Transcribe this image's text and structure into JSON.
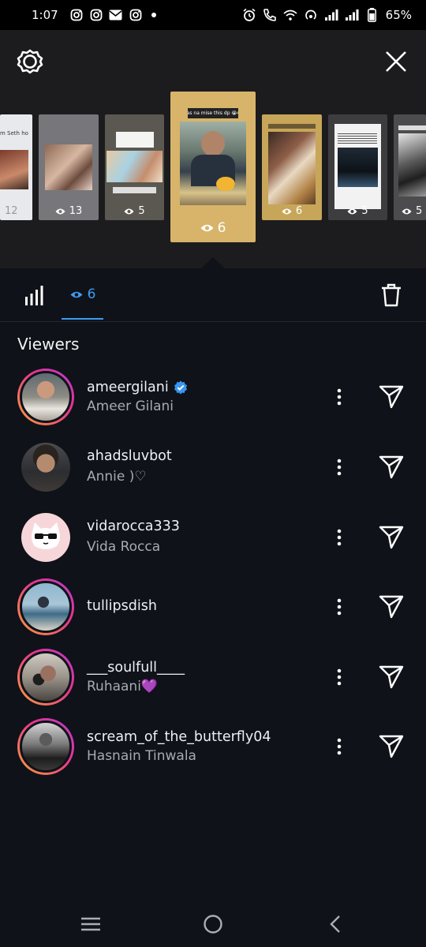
{
  "status_bar": {
    "time": "1:07",
    "battery": "65%"
  },
  "stories": [
    {
      "views": "12"
    },
    {
      "views": "13"
    },
    {
      "views": "5"
    },
    {
      "views": "6",
      "selected": true,
      "caption": "Bas na mise this dp 😭😭"
    },
    {
      "views": "6"
    },
    {
      "views": "5"
    },
    {
      "views": "5"
    }
  ],
  "tabs": {
    "viewers_count": "6"
  },
  "viewers_title": "Viewers",
  "viewers": [
    {
      "username": "ameergilani",
      "name": "Ameer Gilani",
      "verified": true,
      "story_ring": true
    },
    {
      "username": "ahadsluvbot",
      "name": "Annie )♡",
      "verified": false,
      "story_ring": false
    },
    {
      "username": "vidarocca333",
      "name": "Vida Rocca",
      "verified": false,
      "story_ring": false
    },
    {
      "username": "tullipsdish",
      "name": "",
      "verified": false,
      "story_ring": true
    },
    {
      "username": "___soulfull____",
      "name": "Ruhaani💜",
      "verified": false,
      "story_ring": true
    },
    {
      "username": "scream_of_the_butterfly04",
      "name": "Hasnain Tinwala",
      "verified": false,
      "story_ring": true
    }
  ],
  "colors": {
    "accent": "#3f9bf2",
    "background": "#0f1218",
    "top_panel": "#1c1c1e",
    "verified": "#3897f0"
  },
  "icons": {
    "settings": "gear-icon",
    "close": "close-icon",
    "insights": "bar-chart-icon",
    "viewers_tab": "eye-icon",
    "delete": "trash-icon",
    "more": "more-vertical-icon",
    "send": "send-icon"
  }
}
